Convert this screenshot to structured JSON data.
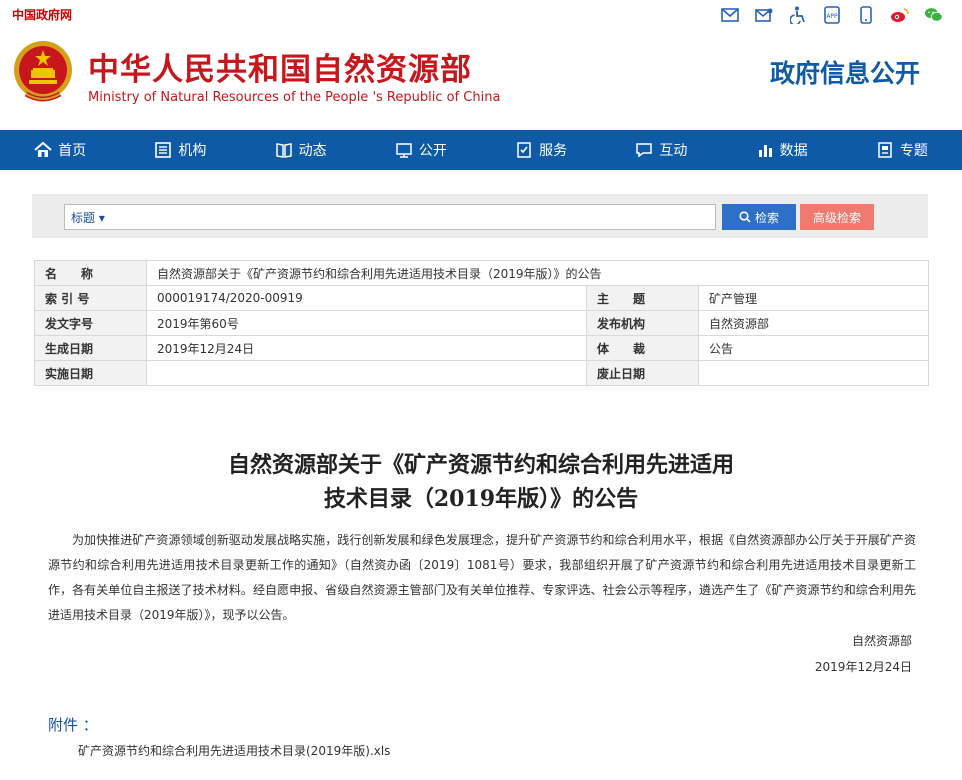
{
  "topbar": {
    "gov_link": "中国政府网",
    "icons": [
      "mail-icon",
      "mail-alt-icon",
      "accessibility-icon",
      "app-icon",
      "mobile-icon",
      "weibo-icon",
      "wechat-icon"
    ]
  },
  "header": {
    "brand_cn": "中华人民共和国自然资源部",
    "brand_en": "Ministry of Natural Resources of the People 's Republic of China",
    "right_title": "政府信息公开"
  },
  "nav": {
    "items": [
      {
        "label": "首页",
        "icon": "home-icon"
      },
      {
        "label": "机构",
        "icon": "org-icon"
      },
      {
        "label": "动态",
        "icon": "news-icon"
      },
      {
        "label": "公开",
        "icon": "disclosure-icon"
      },
      {
        "label": "服务",
        "icon": "service-icon"
      },
      {
        "label": "互动",
        "icon": "interact-icon"
      },
      {
        "label": "数据",
        "icon": "data-icon"
      },
      {
        "label": "专题",
        "icon": "topic-icon"
      }
    ]
  },
  "search": {
    "type_label": "标题 ▾",
    "placeholder": "",
    "search_button": "检索",
    "advanced_button": "高级检索"
  },
  "meta": {
    "name_label": "名　　称",
    "name_value": "自然资源部关于《矿产资源节约和综合利用先进适用技术目录（2019年版）》的公告",
    "index_label": "索 引 号",
    "index_value": "000019174/2020-00919",
    "subject_label": "主　　题",
    "subject_value": "矿产管理",
    "docno_label": "发文字号",
    "docno_value": "2019年第60号",
    "publisher_label": "发布机构",
    "publisher_value": "自然资源部",
    "date_label": "生成日期",
    "date_value": "2019年12月24日",
    "genre_label": "体　　裁",
    "genre_value": "公告",
    "impl_label": "实施日期",
    "impl_value": "",
    "abolish_label": "废止日期",
    "abolish_value": ""
  },
  "article": {
    "title_line1": "自然资源部关于《矿产资源节约和综合利用先进适用",
    "title_line2": "技术目录（2019年版）》的公告",
    "body": "为加快推进矿产资源领域创新驱动发展战略实施，践行创新发展和绿色发展理念，提升矿产资源节约和综合利用水平，根据《自然资源部办公厅关于开展矿产资源节约和综合利用先进适用技术目录更新工作的通知》（自然资办函〔2019〕1081号）要求，我部组织开展了矿产资源节约和综合利用先进适用技术目录更新工作，各有关单位自主报送了技术材料。经自愿申报、省级自然资源主管部门及有关单位推荐、专家评选、社会公示等程序，遴选产生了《矿产资源节约和综合利用先进适用技术目录（2019年版）》，现予以公告。",
    "signer": "自然资源部",
    "sign_date": "2019年12月24日",
    "attachment_label": "附件 ：",
    "attachment_file": "矿产资源节约和综合利用先进适用技术目录(2019年版).xls"
  },
  "colors": {
    "brand_red": "#c8161d",
    "nav_blue": "#0e5aa7",
    "search_blue": "#2e6fc8",
    "advanced_red": "#f07a70"
  }
}
